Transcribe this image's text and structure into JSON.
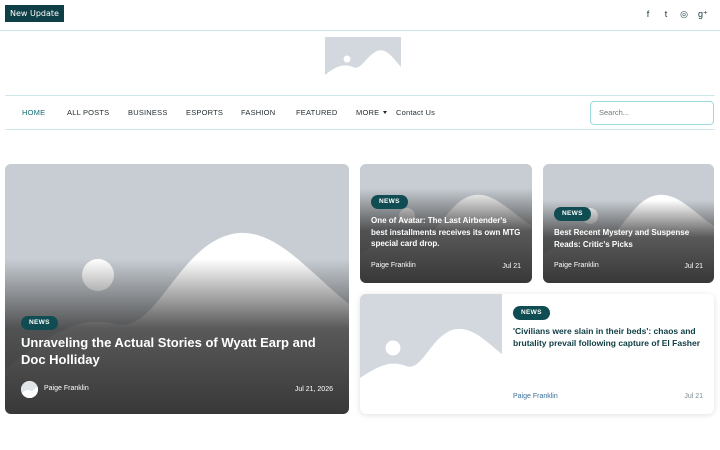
{
  "topbar": {
    "update_label": "New Update",
    "social_icons": [
      "facebook-icon",
      "twitter-icon",
      "instagram-icon",
      "google-plus-icon"
    ],
    "social_glyphs": [
      "f",
      "t",
      "◎",
      "g⁺"
    ]
  },
  "nav": {
    "items": [
      "HOME",
      "ALL POSTS",
      "BUSINESS",
      "ESPORTS",
      "FASHION",
      "FEATURED",
      "MORE",
      "Contact Us"
    ]
  },
  "search": {
    "placeholder": "Search..."
  },
  "featured": {
    "category": "NEWS",
    "title": "Unraveling the Actual Stories of Wyatt Earp and Doc Holliday",
    "author": "Paige Franklin",
    "date": "Jul 21, 2026"
  },
  "cards": [
    {
      "category": "NEWS",
      "title": "One of Avatar: The Last Airbender's best installments receives its own MTG special card drop.",
      "author": "Paige Franklin",
      "date": "Jul 21"
    },
    {
      "category": "NEWS",
      "title": "Best Recent Mystery and Suspense Reads: Critic's Picks",
      "author": "Paige Franklin",
      "date": "Jul 21"
    }
  ],
  "side_article": {
    "category": "NEWS",
    "title": "'Civilians were slain in their beds': chaos and brutality prevail following capture of El Fasher",
    "author": "Paige Franklin",
    "date": "Jul 21"
  },
  "colors": {
    "accent": "#0f4d52",
    "nav_border": "#cfe9ea",
    "search_border": "#9cdadd"
  }
}
